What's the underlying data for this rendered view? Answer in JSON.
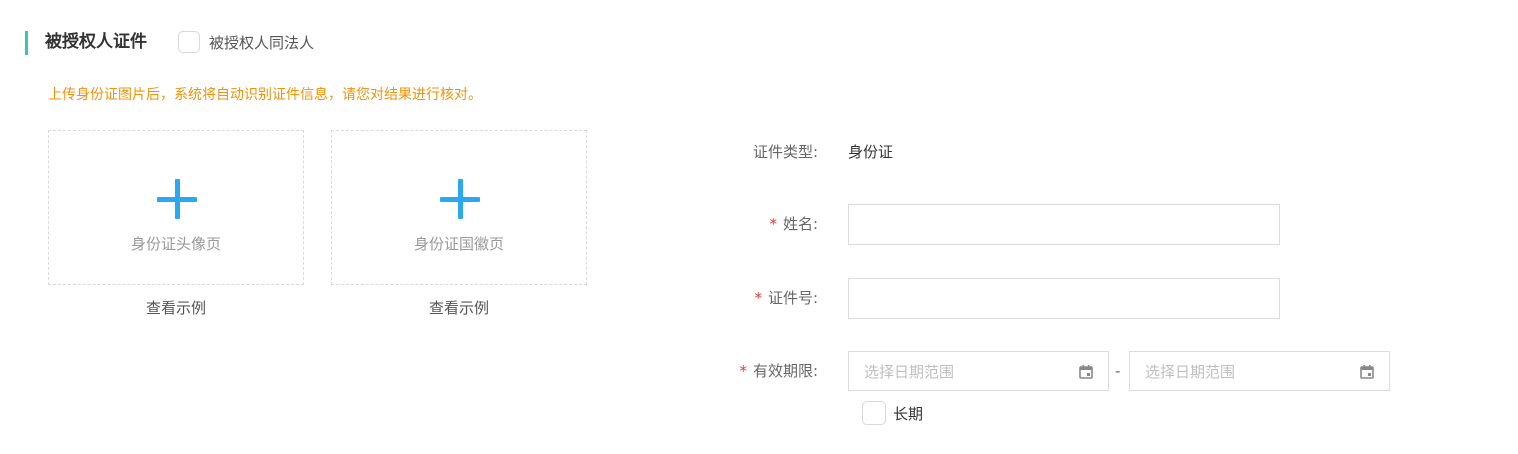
{
  "section": {
    "title": "被授权人证件",
    "same_as_legal_label": "被授权人同法人"
  },
  "upload": {
    "tip": "上传身份证图片后，系统将自动识别证件信息，请您对结果进行核对。",
    "front_label": "身份证头像页",
    "back_label": "身份证国徽页",
    "example_label": "查看示例"
  },
  "form": {
    "required_mark": "*",
    "id_type_label": "证件类型:",
    "id_type_value": "身份证",
    "name_label": "姓名:",
    "name_value": "",
    "id_number_label": "证件号:",
    "id_number_value": "",
    "validity_label": "有效期限:",
    "date_placeholder": "选择日期范围",
    "date_separator": "-",
    "long_term_label": "长期"
  },
  "colors": {
    "accent": "#3fc4b2",
    "tip": "#f0920a",
    "plus": "#2aa8f2",
    "required": "#e03c3c"
  }
}
